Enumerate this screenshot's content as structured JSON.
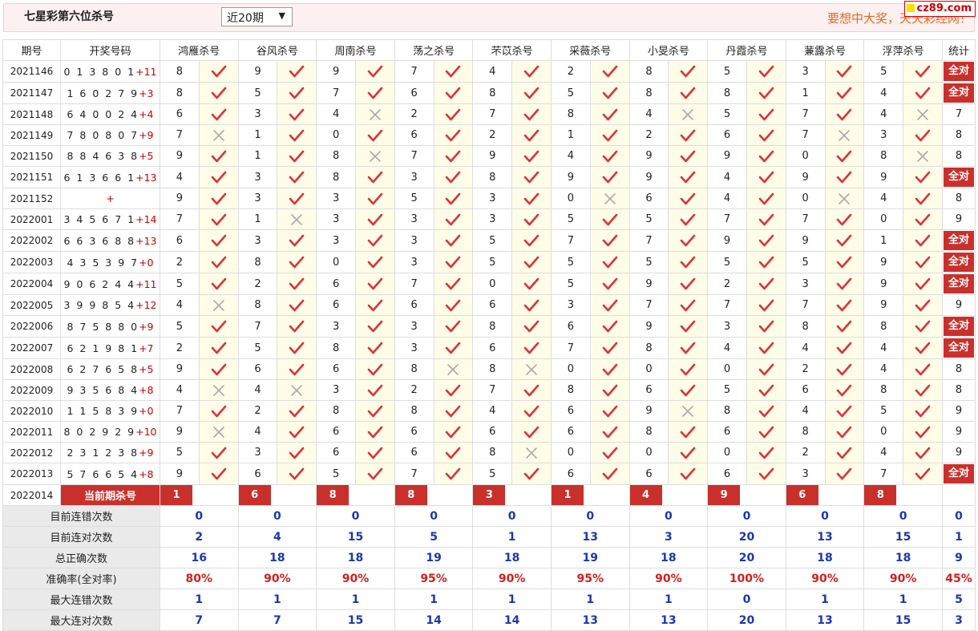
{
  "header": {
    "title": "七星彩第六位杀号",
    "period": "近20期",
    "slogan": "要想中大奖，天天彩经网！",
    "logo": "cz89.com"
  },
  "columns": {
    "issue": "期号",
    "draw": "开奖号码",
    "stats": "统计"
  },
  "experts": [
    "鸿雁杀号",
    "谷风杀号",
    "周南杀号",
    "荡之杀号",
    "芣苡杀号",
    "采薇杀号",
    "小旻杀号",
    "丹霞杀号",
    "蒹露杀号",
    "浮萍杀号"
  ],
  "rows": [
    {
      "issue": "2021146",
      "digits": "0 1 3 8 0 1",
      "extra": "+11",
      "kill": [
        "8",
        "9",
        "9",
        "7",
        "4",
        "2",
        "8",
        "5",
        "3",
        "5"
      ],
      "ok": [
        1,
        1,
        1,
        1,
        1,
        1,
        1,
        1,
        1,
        1
      ],
      "stat": "全对"
    },
    {
      "issue": "2021147",
      "digits": "1 6 0 2 7 9",
      "extra": "+3",
      "kill": [
        "8",
        "5",
        "7",
        "6",
        "8",
        "5",
        "8",
        "8",
        "1",
        "4"
      ],
      "ok": [
        1,
        1,
        1,
        1,
        1,
        1,
        1,
        1,
        1,
        1
      ],
      "stat": "全对"
    },
    {
      "issue": "2021148",
      "digits": "6 4 0 0 2 4",
      "extra": "+4",
      "kill": [
        "6",
        "3",
        "4",
        "2",
        "7",
        "8",
        "4",
        "5",
        "7",
        "4"
      ],
      "ok": [
        1,
        1,
        0,
        1,
        1,
        1,
        0,
        1,
        1,
        0
      ],
      "stat": "7"
    },
    {
      "issue": "2021149",
      "digits": "7 8 0 8 0 7",
      "extra": "+9",
      "kill": [
        "7",
        "1",
        "0",
        "6",
        "2",
        "1",
        "2",
        "6",
        "7",
        "3"
      ],
      "ok": [
        0,
        1,
        1,
        1,
        1,
        1,
        1,
        1,
        0,
        1
      ],
      "stat": "8"
    },
    {
      "issue": "2021150",
      "digits": "8 8 4 6 3 8",
      "extra": "+5",
      "kill": [
        "9",
        "1",
        "8",
        "7",
        "9",
        "4",
        "9",
        "9",
        "0",
        "8"
      ],
      "ok": [
        1,
        1,
        0,
        1,
        1,
        1,
        1,
        1,
        1,
        0
      ],
      "stat": "8"
    },
    {
      "issue": "2021151",
      "digits": "6 1 3 6 6 1",
      "extra": "+13",
      "kill": [
        "4",
        "3",
        "8",
        "3",
        "8",
        "9",
        "9",
        "4",
        "9",
        "9"
      ],
      "ok": [
        1,
        1,
        1,
        1,
        1,
        1,
        1,
        1,
        1,
        1
      ],
      "stat": "全对"
    },
    {
      "issue": "2021152",
      "digits": "",
      "extra": "+",
      "kill": [
        "9",
        "3",
        "3",
        "5",
        "3",
        "0",
        "6",
        "4",
        "0",
        "4"
      ],
      "ok": [
        1,
        1,
        1,
        1,
        1,
        0,
        1,
        1,
        0,
        1
      ],
      "stat": "8"
    },
    {
      "issue": "2022001",
      "digits": "3 4 5 6 7 1",
      "extra": "+14",
      "kill": [
        "7",
        "1",
        "3",
        "3",
        "3",
        "5",
        "5",
        "7",
        "7",
        "0"
      ],
      "ok": [
        1,
        0,
        1,
        1,
        1,
        1,
        1,
        1,
        1,
        1
      ],
      "stat": "9"
    },
    {
      "issue": "2022002",
      "digits": "6 6 3 6 8 8",
      "extra": "+13",
      "kill": [
        "6",
        "3",
        "3",
        "3",
        "5",
        "7",
        "7",
        "9",
        "9",
        "1"
      ],
      "ok": [
        1,
        1,
        1,
        1,
        1,
        1,
        1,
        1,
        1,
        1
      ],
      "stat": "全对"
    },
    {
      "issue": "2022003",
      "digits": "4 3 5 3 9 7",
      "extra": "+0",
      "kill": [
        "2",
        "8",
        "0",
        "3",
        "5",
        "5",
        "5",
        "5",
        "5",
        "9"
      ],
      "ok": [
        1,
        1,
        1,
        1,
        1,
        1,
        1,
        1,
        1,
        1
      ],
      "stat": "全对"
    },
    {
      "issue": "2022004",
      "digits": "9 0 6 2 4 4",
      "extra": "+11",
      "kill": [
        "5",
        "2",
        "6",
        "7",
        "0",
        "5",
        "9",
        "2",
        "3",
        "9"
      ],
      "ok": [
        1,
        1,
        1,
        1,
        1,
        1,
        1,
        1,
        1,
        1
      ],
      "stat": "全对"
    },
    {
      "issue": "2022005",
      "digits": "3 9 9 8 5 4",
      "extra": "+12",
      "kill": [
        "4",
        "8",
        "6",
        "6",
        "6",
        "3",
        "7",
        "7",
        "7",
        "9"
      ],
      "ok": [
        0,
        1,
        1,
        1,
        1,
        1,
        1,
        1,
        1,
        1
      ],
      "stat": "9"
    },
    {
      "issue": "2022006",
      "digits": "8 7 5 8 8 0",
      "extra": "+9",
      "kill": [
        "5",
        "7",
        "3",
        "3",
        "8",
        "6",
        "9",
        "3",
        "8",
        "8"
      ],
      "ok": [
        1,
        1,
        1,
        1,
        1,
        1,
        1,
        1,
        1,
        1
      ],
      "stat": "全对"
    },
    {
      "issue": "2022007",
      "digits": "6 2 1 9 8 1",
      "extra": "+7",
      "kill": [
        "2",
        "5",
        "8",
        "3",
        "6",
        "7",
        "8",
        "4",
        "4",
        "4"
      ],
      "ok": [
        1,
        1,
        1,
        1,
        1,
        1,
        1,
        1,
        1,
        1
      ],
      "stat": "全对"
    },
    {
      "issue": "2022008",
      "digits": "6 2 7 6 5 8",
      "extra": "+5",
      "kill": [
        "9",
        "6",
        "6",
        "8",
        "8",
        "0",
        "0",
        "0",
        "2",
        "4"
      ],
      "ok": [
        1,
        1,
        1,
        0,
        0,
        1,
        1,
        1,
        1,
        1
      ],
      "stat": "8"
    },
    {
      "issue": "2022009",
      "digits": "9 3 5 6 8 4",
      "extra": "+8",
      "kill": [
        "4",
        "4",
        "3",
        "2",
        "7",
        "8",
        "6",
        "5",
        "6",
        "8"
      ],
      "ok": [
        0,
        0,
        1,
        1,
        1,
        1,
        1,
        1,
        1,
        1
      ],
      "stat": "8"
    },
    {
      "issue": "2022010",
      "digits": "1 1 5 8 3 9",
      "extra": "+0",
      "kill": [
        "7",
        "2",
        "8",
        "8",
        "4",
        "6",
        "9",
        "8",
        "4",
        "5"
      ],
      "ok": [
        1,
        1,
        1,
        1,
        1,
        1,
        0,
        1,
        1,
        1
      ],
      "stat": "9"
    },
    {
      "issue": "2022011",
      "digits": "8 0 2 9 2 9",
      "extra": "+10",
      "kill": [
        "9",
        "4",
        "6",
        "6",
        "6",
        "6",
        "8",
        "6",
        "8",
        "0"
      ],
      "ok": [
        0,
        1,
        1,
        1,
        1,
        1,
        1,
        1,
        1,
        1
      ],
      "stat": "9"
    },
    {
      "issue": "2022012",
      "digits": "2 3 1 2 3 8",
      "extra": "+9",
      "kill": [
        "5",
        "3",
        "6",
        "6",
        "8",
        "0",
        "0",
        "0",
        "2",
        "4"
      ],
      "ok": [
        1,
        1,
        1,
        1,
        0,
        1,
        1,
        1,
        1,
        1
      ],
      "stat": "9"
    },
    {
      "issue": "2022013",
      "digits": "5 7 6 6 5 4",
      "extra": "+8",
      "kill": [
        "9",
        "6",
        "5",
        "7",
        "5",
        "6",
        "6",
        "6",
        "3",
        "7"
      ],
      "ok": [
        1,
        1,
        1,
        1,
        1,
        1,
        1,
        1,
        1,
        1
      ],
      "stat": "全对"
    }
  ],
  "current": {
    "issue": "2022014",
    "label": "当前期杀号",
    "kill": [
      "1",
      "6",
      "8",
      "8",
      "3",
      "1",
      "4",
      "9",
      "6",
      "8"
    ]
  },
  "summary": [
    {
      "label": "目前连错次数",
      "values": [
        "0",
        "0",
        "0",
        "0",
        "0",
        "0",
        "0",
        "0",
        "0",
        "0"
      ],
      "total": "0",
      "red": false
    },
    {
      "label": "目前连对次数",
      "values": [
        "2",
        "4",
        "15",
        "5",
        "1",
        "13",
        "3",
        "20",
        "13",
        "15"
      ],
      "total": "1",
      "red": false
    },
    {
      "label": "总正确次数",
      "values": [
        "16",
        "18",
        "18",
        "19",
        "18",
        "19",
        "18",
        "20",
        "18",
        "18"
      ],
      "total": "9",
      "red": false
    },
    {
      "label": "准确率(全对率)",
      "values": [
        "80%",
        "90%",
        "90%",
        "95%",
        "90%",
        "95%",
        "90%",
        "100%",
        "90%",
        "90%"
      ],
      "total": "45%",
      "red": true
    },
    {
      "label": "最大连错次数",
      "values": [
        "1",
        "1",
        "1",
        "1",
        "1",
        "1",
        "1",
        "0",
        "1",
        "1"
      ],
      "total": "5",
      "red": false
    },
    {
      "label": "最大连对次数",
      "values": [
        "7",
        "7",
        "15",
        "14",
        "14",
        "13",
        "13",
        "20",
        "13",
        "15"
      ],
      "total": "3",
      "red": false
    }
  ],
  "colors": {
    "accent": "#c9302c",
    "check": "#e0303a",
    "cross": "#aaaaaa",
    "value_blue": "#1a37b0"
  }
}
